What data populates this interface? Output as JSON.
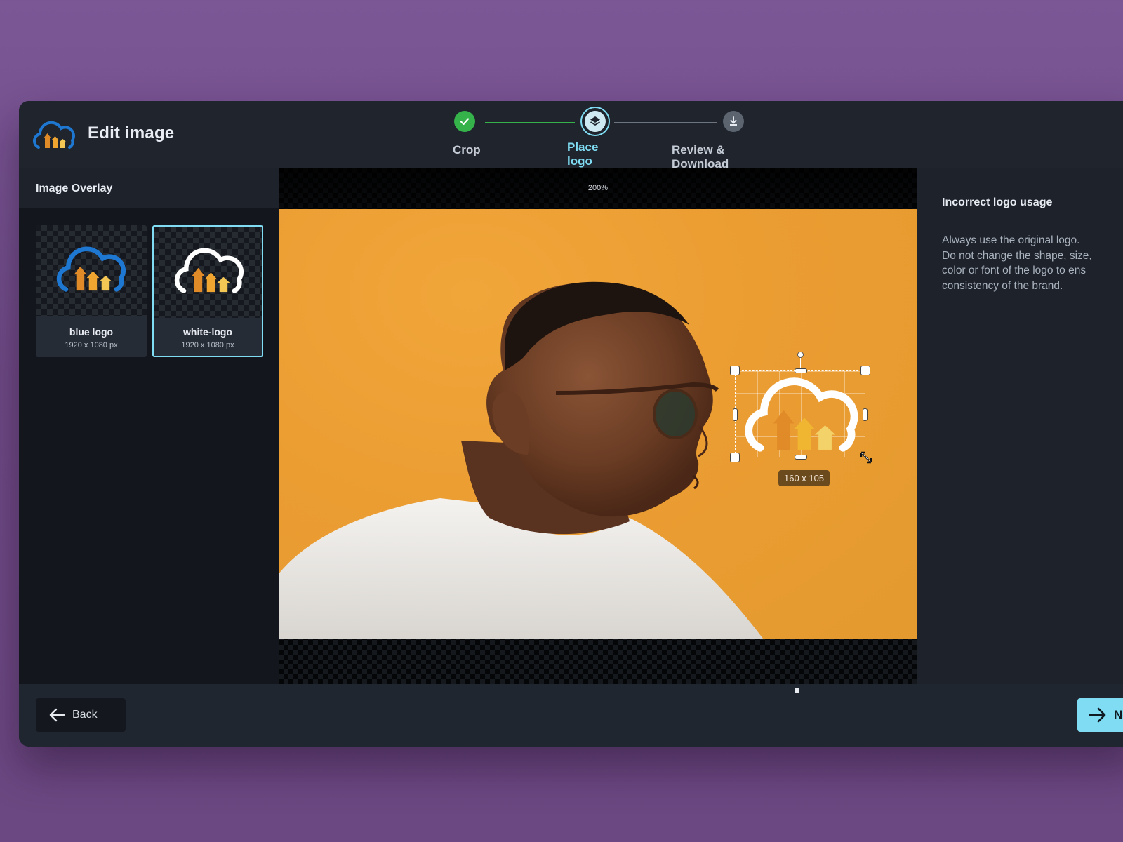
{
  "header": {
    "title": "Edit image",
    "steps": [
      {
        "label": "Crop",
        "state": "done"
      },
      {
        "label": "Place logo",
        "state": "active"
      },
      {
        "label": "Review & Download",
        "state": "pending"
      }
    ]
  },
  "left_panel": {
    "title": "Image Overlay",
    "logos": [
      {
        "name": "blue logo",
        "size": "1920 x 1080 px",
        "selected": false
      },
      {
        "name": "white-logo",
        "size": "1920 x 1080 px",
        "selected": true
      }
    ]
  },
  "canvas": {
    "zoom": "200%",
    "overlay_size": "160 x 105"
  },
  "right_panel": {
    "title": "Incorrect logo usage",
    "lines": [
      "Always use the original logo.",
      "Do not change the shape, size,",
      "color or font of the logo to ens",
      "consistency of the brand."
    ]
  },
  "footer": {
    "back_label": "Back",
    "next_label": "Ne"
  },
  "colors": {
    "accent": "#7fdcf2",
    "success": "#35b24a",
    "background": "#7a5591",
    "photo_bg": "#eb9d32"
  },
  "icons": [
    "cloud-logo-icon",
    "check-icon",
    "layers-icon",
    "download-icon",
    "arrow-left-icon",
    "arrow-right-icon",
    "resize-icon"
  ]
}
